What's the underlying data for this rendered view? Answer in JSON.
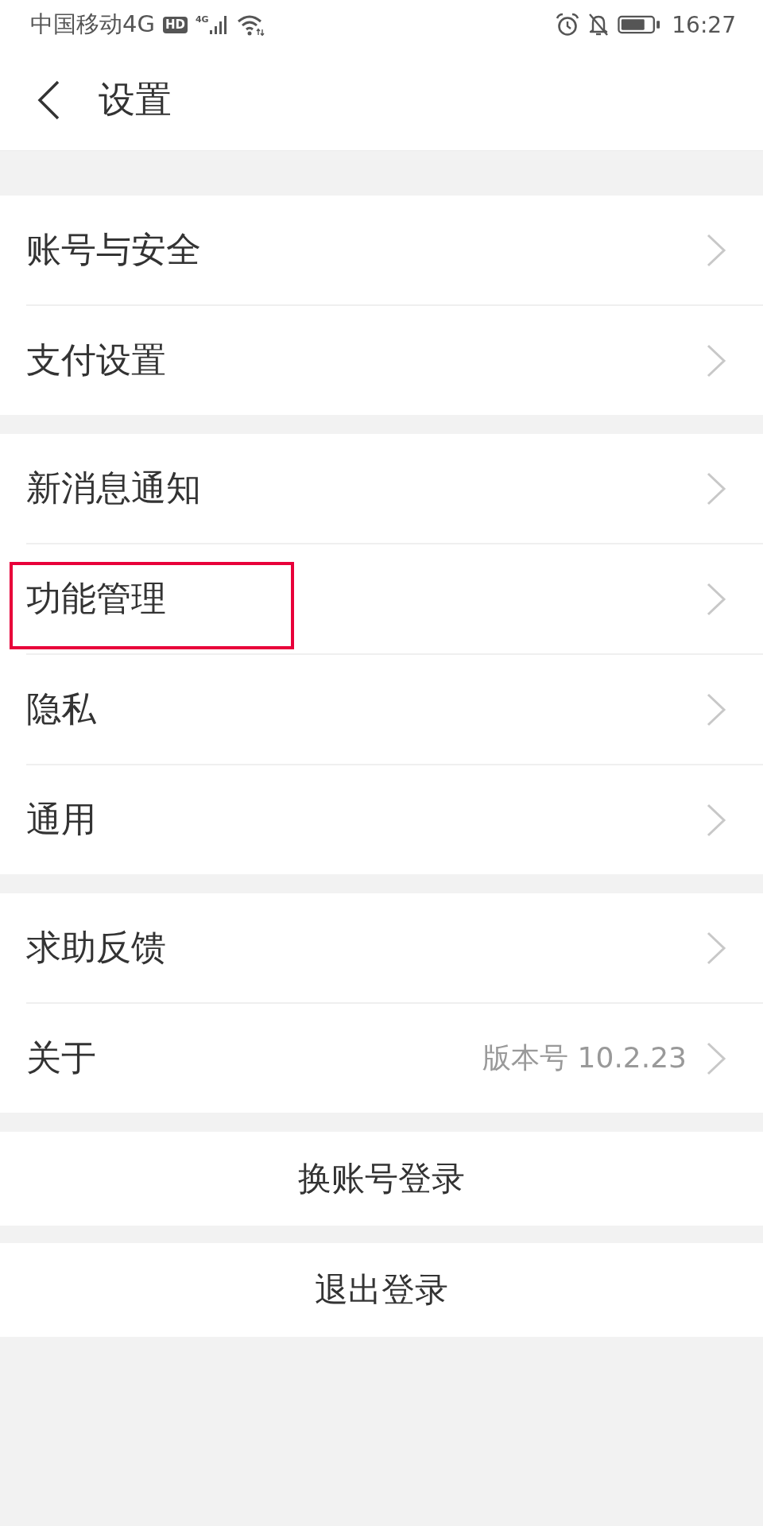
{
  "status_bar": {
    "carrier": "中国移动4G",
    "network_badge": "HD",
    "signal_label": "4G",
    "time": "16:27"
  },
  "header": {
    "title": "设置"
  },
  "groups": [
    {
      "items": [
        {
          "label": "账号与安全",
          "highlighted": false
        },
        {
          "label": "支付设置",
          "highlighted": false
        }
      ]
    },
    {
      "items": [
        {
          "label": "新消息通知",
          "highlighted": false
        },
        {
          "label": "功能管理",
          "highlighted": true
        },
        {
          "label": "隐私",
          "highlighted": false
        },
        {
          "label": "通用",
          "highlighted": false
        }
      ]
    },
    {
      "items": [
        {
          "label": "求助反馈",
          "highlighted": false
        },
        {
          "label": "关于",
          "value": "版本号 10.2.23",
          "highlighted": false
        }
      ]
    }
  ],
  "actions": [
    {
      "label": "换账号登录"
    },
    {
      "label": "退出登录"
    }
  ]
}
